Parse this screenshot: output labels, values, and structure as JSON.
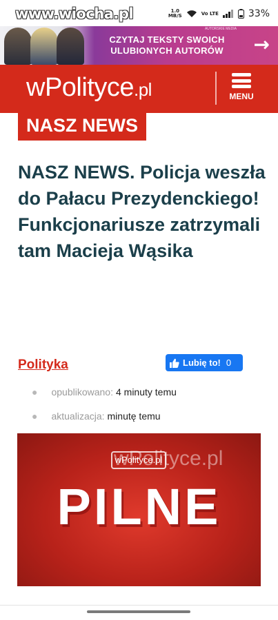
{
  "status_bar": {
    "watermark": "www.wiocha.pl",
    "net_speed_value": "1.0",
    "net_speed_unit": "MB/S",
    "network_label": "Vo LTE",
    "battery": "33%",
    "icons": [
      "wifi-icon",
      "signal-icon",
      "battery-icon"
    ]
  },
  "ad_banner": {
    "small_text": "AUTORSKIE MEDIA",
    "line1": "CZYTAJ TEKSTY SWOICH",
    "line2": "ULUBIONYCH AUTORÓW",
    "arrow": "→"
  },
  "header": {
    "logo_main": "wPolityce",
    "logo_suffix": ".pl",
    "menu_label": "MENU",
    "background_color": "#d42a1b"
  },
  "article": {
    "category_badge": "NASZ NEWS",
    "title": "NASZ NEWS. Policja weszła do Pałacu Prezydenckiego! Funkcjonariusze zatrzymali tam Macieja Wąsika",
    "section": "Polityka",
    "meta": {
      "published_label": "opublikowano:",
      "published_value": "4 minuty temu",
      "updated_label": "aktualizacja:",
      "updated_value": "minutę temu"
    },
    "image": {
      "watermark": "wPolityce.pl",
      "logo_box": "wPolityce.pl",
      "text": "PILNE"
    }
  },
  "facebook": {
    "like_label": "Lubię to!",
    "like_count": "0",
    "color": "#1877f2"
  },
  "colors": {
    "accent": "#d42a1b",
    "headline": "#1b3f4a"
  }
}
